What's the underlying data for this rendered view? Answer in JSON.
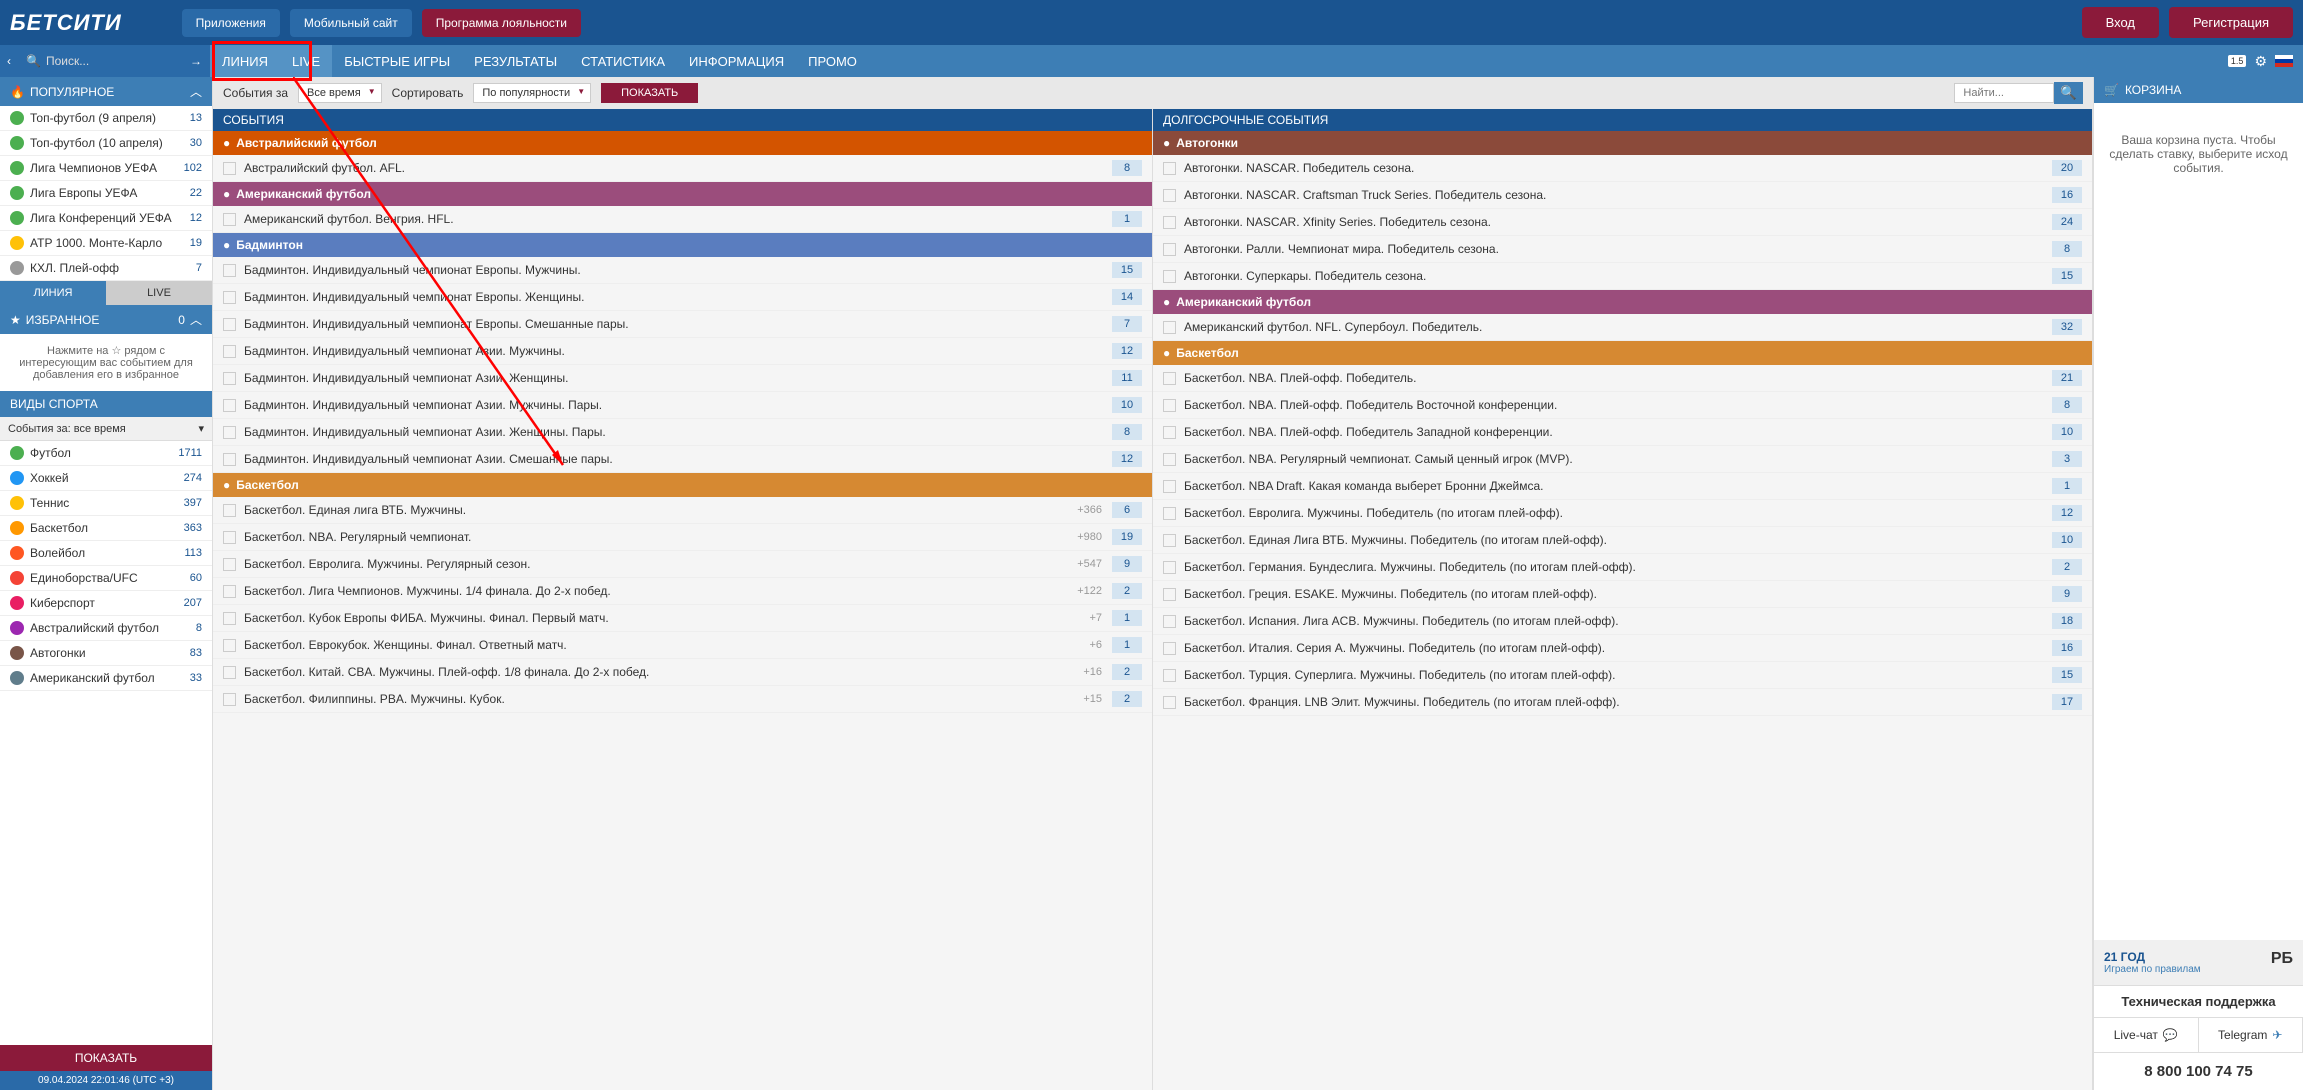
{
  "header": {
    "logo": "БЕТСИТИ",
    "apps": "Приложения",
    "mobile": "Мобильный сайт",
    "loyalty": "Программа лояльности",
    "login": "Вход",
    "register": "Регистрация"
  },
  "nav": {
    "search_placeholder": "Поиск...",
    "tabs": [
      "ЛИНИЯ",
      "LIVE",
      "БЫСТРЫЕ ИГРЫ",
      "РЕЗУЛЬТАТЫ",
      "СТАТИСТИКА",
      "ИНФОРМАЦИЯ",
      "ПРОМО"
    ],
    "ver": "1.5"
  },
  "popular": {
    "title": "ПОПУЛЯРНОЕ",
    "items": [
      {
        "name": "Топ-футбол (9 апреля)",
        "count": "13",
        "color": "green"
      },
      {
        "name": "Топ-футбол (10 апреля)",
        "count": "30",
        "color": "green"
      },
      {
        "name": "Лига Чемпионов УЕФА",
        "count": "102",
        "color": "green"
      },
      {
        "name": "Лига Европы УЕФА",
        "count": "22",
        "color": "green"
      },
      {
        "name": "Лига Конференций УЕФА",
        "count": "12",
        "color": "green"
      },
      {
        "name": "ATP 1000. Монте-Карло",
        "count": "19",
        "color": "yellow"
      },
      {
        "name": "КХЛ. Плей-офф",
        "count": "7",
        "color": "gray"
      }
    ]
  },
  "tabs2": {
    "line": "ЛИНИЯ",
    "live": "LIVE"
  },
  "fav": {
    "title": "ИЗБРАННОЕ",
    "count": "0",
    "text": "Нажмите на ☆ рядом с интересующим вас событием для добавления его в избранное"
  },
  "sports_section": {
    "title": "ВИДЫ СПОРТА",
    "dropdown": "События за: все время",
    "items": [
      {
        "name": "Футбол",
        "count": "1711",
        "color": "#4caf50"
      },
      {
        "name": "Хоккей",
        "count": "274",
        "color": "#2196f3"
      },
      {
        "name": "Теннис",
        "count": "397",
        "color": "#ffc107"
      },
      {
        "name": "Баскетбол",
        "count": "363",
        "color": "#ff9800"
      },
      {
        "name": "Волейбол",
        "count": "113",
        "color": "#ff5722"
      },
      {
        "name": "Единоборства/UFC",
        "count": "60",
        "color": "#f44336"
      },
      {
        "name": "Киберспорт",
        "count": "207",
        "color": "#e91e63"
      },
      {
        "name": "Австралийский футбол",
        "count": "8",
        "color": "#9c27b0"
      },
      {
        "name": "Автогонки",
        "count": "83",
        "color": "#795548"
      },
      {
        "name": "Американский футбол",
        "count": "33",
        "color": "#607d8b"
      }
    ],
    "show": "ПОКАЗАТЬ",
    "datetime": "09.04.2024 22:01:46 (UTC +3)"
  },
  "filter": {
    "events_for": "События за",
    "all_time": "Все время",
    "sort": "Сортировать",
    "by_pop": "По популярности",
    "show": "ПОКАЗАТЬ",
    "find": "Найти..."
  },
  "col1": {
    "title": "СОБЫТИЯ",
    "bands": [
      {
        "title": "Австралийский футбол",
        "cls": "afl",
        "events": [
          {
            "name": "Австралийский футбол. AFL.",
            "count": "8"
          }
        ]
      },
      {
        "title": "Американский футбол",
        "cls": "amf",
        "events": [
          {
            "name": "Американский футбол. Венгрия. HFL.",
            "count": "1"
          }
        ]
      },
      {
        "title": "Бадминтон",
        "cls": "bad",
        "events": [
          {
            "name": "Бадминтон. Индивидуальный чемпионат Европы. Мужчины.",
            "count": "15"
          },
          {
            "name": "Бадминтон. Индивидуальный чемпионат Европы. Женщины.",
            "count": "14"
          },
          {
            "name": "Бадминтон. Индивидуальный чемпионат Европы. Смешанные пары.",
            "count": "7"
          },
          {
            "name": "Бадминтон. Индивидуальный чемпионат Азии. Мужчины.",
            "count": "12"
          },
          {
            "name": "Бадминтон. Индивидуальный чемпионат Азии. Женщины.",
            "count": "11"
          },
          {
            "name": "Бадминтон. Индивидуальный чемпионат Азии. Мужчины. Пары.",
            "count": "10"
          },
          {
            "name": "Бадминтон. Индивидуальный чемпионат Азии. Женщины. Пары.",
            "count": "8"
          },
          {
            "name": "Бадминтон. Индивидуальный чемпионат Азии. Смешанные пары.",
            "count": "12"
          }
        ]
      },
      {
        "title": "Баскетбол",
        "cls": "bask",
        "events": [
          {
            "name": "Баскетбол. Единая лига ВТБ. Мужчины.",
            "extra": "+366",
            "count": "6"
          },
          {
            "name": "Баскетбол. NBA. Регулярный чемпионат.",
            "extra": "+980",
            "count": "19"
          },
          {
            "name": "Баскетбол. Евролига. Мужчины. Регулярный сезон.",
            "extra": "+547",
            "count": "9"
          },
          {
            "name": "Баскетбол. Лига Чемпионов. Мужчины. 1/4 финала. До 2-х побед.",
            "extra": "+122",
            "count": "2"
          },
          {
            "name": "Баскетбол. Кубок Европы ФИБА. Мужчины. Финал. Первый матч.",
            "extra": "+7",
            "count": "1"
          },
          {
            "name": "Баскетбол. Еврокубок. Женщины. Финал. Ответный матч.",
            "extra": "+6",
            "count": "1"
          },
          {
            "name": "Баскетбол. Китай. CBA. Мужчины. Плей-офф. 1/8 финала. До 2-х побед.",
            "extra": "+16",
            "count": "2"
          },
          {
            "name": "Баскетбол. Филиппины. PBA. Мужчины. Кубок.",
            "extra": "+15",
            "count": "2"
          }
        ]
      }
    ]
  },
  "col2": {
    "title": "ДОЛГОСРОЧНЫЕ СОБЫТИЯ",
    "bands": [
      {
        "title": "Автогонки",
        "cls": "autog",
        "events": [
          {
            "name": "Автогонки. NASCAR. Победитель сезона.",
            "count": "20"
          },
          {
            "name": "Автогонки. NASCAR. Craftsman Truck Series. Победитель сезона.",
            "count": "16"
          },
          {
            "name": "Автогонки. NASCAR. Xfinity Series. Победитель сезона.",
            "count": "24"
          },
          {
            "name": "Автогонки. Ралли. Чемпионат мира. Победитель сезона.",
            "count": "8"
          },
          {
            "name": "Автогонки. Суперкары. Победитель сезона.",
            "count": "15"
          }
        ]
      },
      {
        "title": "Американский футбол",
        "cls": "amf",
        "events": [
          {
            "name": "Американский футбол. NFL. Супербоул. Победитель.",
            "count": "32"
          }
        ]
      },
      {
        "title": "Баскетбол",
        "cls": "bask",
        "events": [
          {
            "name": "Баскетбол. NBA. Плей-офф. Победитель.",
            "count": "21"
          },
          {
            "name": "Баскетбол. NBA. Плей-офф. Победитель Восточной конференции.",
            "count": "8"
          },
          {
            "name": "Баскетбол. NBA. Плей-офф. Победитель Западной конференции.",
            "count": "10"
          },
          {
            "name": "Баскетбол. NBA. Регулярный чемпионат. Самый ценный игрок (MVP).",
            "count": "3"
          },
          {
            "name": "Баскетбол. NBA Draft. Какая команда выберет Бронни Джеймса.",
            "count": "1"
          },
          {
            "name": "Баскетбол. Евролига. Мужчины. Победитель (по итогам плей-офф).",
            "count": "12"
          },
          {
            "name": "Баскетбол. Единая Лига ВТБ. Мужчины. Победитель (по итогам плей-офф).",
            "count": "10"
          },
          {
            "name": "Баскетбол. Германия. Бундеслига. Мужчины. Победитель (по итогам плей-офф).",
            "count": "2"
          },
          {
            "name": "Баскетбол. Греция. ESAKE. Мужчины. Победитель (по итогам плей-офф).",
            "count": "9"
          },
          {
            "name": "Баскетбол. Испания. Лига ACB. Мужчины. Победитель (по итогам плей-офф).",
            "count": "18"
          },
          {
            "name": "Баскетбол. Италия. Серия А. Мужчины. Победитель (по итогам плей-офф).",
            "count": "16"
          },
          {
            "name": "Баскетбол. Турция. Суперлига. Мужчины. Победитель (по итогам плей-офф).",
            "count": "15"
          },
          {
            "name": "Баскетбол. Франция. LNB Элит. Мужчины. Победитель (по итогам плей-офф).",
            "count": "17"
          }
        ]
      }
    ]
  },
  "cart": {
    "title": "КОРЗИНА",
    "empty": "Ваша корзина пуста. Чтобы сделать ставку, выберите исход события."
  },
  "promo": {
    "title": "21 ГОД",
    "sub": "Играем по правилам",
    "logo": "РБ"
  },
  "support": {
    "title": "Техническая поддержка",
    "chat": "Live-чат",
    "telegram": "Telegram",
    "phone": "8 800 100 74 75"
  }
}
